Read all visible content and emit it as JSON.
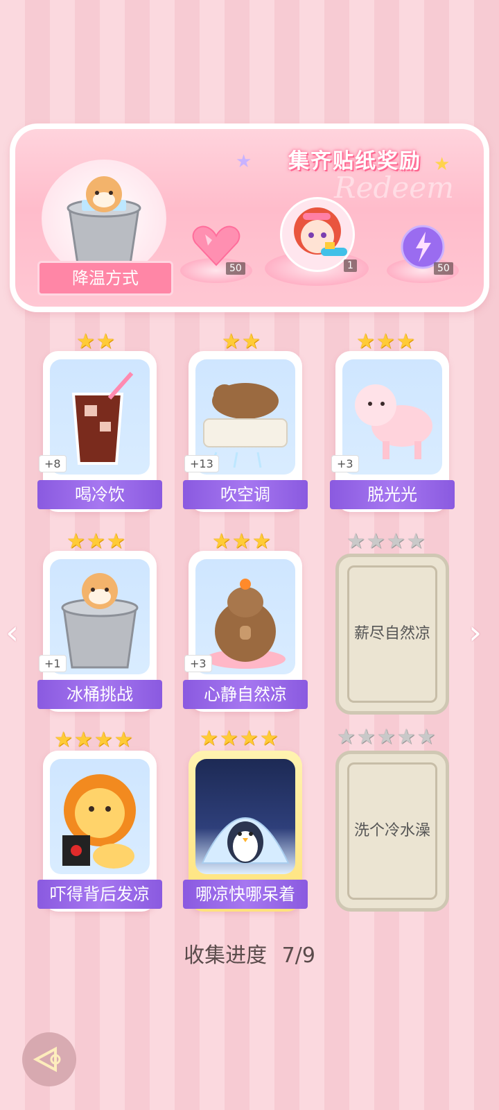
{
  "banner": {
    "title": "集齐贴纸奖励",
    "script": "Redeem",
    "main_label": "降温方式",
    "rewards": [
      {
        "icon": "pink-heart-gem-icon",
        "count": "50"
      },
      {
        "icon": "character-avatar-icon",
        "count": "1"
      },
      {
        "icon": "purple-energy-orb-icon",
        "count": "50"
      }
    ]
  },
  "cards": [
    {
      "title": "喝冷饮",
      "bonus": "+8",
      "stars": 2,
      "locked": false,
      "icon": "iced-drink-icon"
    },
    {
      "title": "吹空调",
      "bonus": "+13",
      "stars": 2,
      "locked": false,
      "icon": "capybara-aircon-icon"
    },
    {
      "title": "脱光光",
      "bonus": "+3",
      "stars": 3,
      "locked": false,
      "icon": "pink-sheep-icon"
    },
    {
      "title": "冰桶挑战",
      "bonus": "+1",
      "stars": 3,
      "locked": false,
      "icon": "hamster-bucket-icon"
    },
    {
      "title": "心静自然凉",
      "bonus": "+3",
      "stars": 3,
      "locked": false,
      "icon": "meditating-capybara-icon"
    },
    {
      "title": "薪尽自然凉",
      "bonus": "",
      "stars": 4,
      "locked": true,
      "icon": "locked-card-icon"
    },
    {
      "title": "吓得背后发凉",
      "bonus": "",
      "stars": 4,
      "locked": false,
      "icon": "scared-lion-icon"
    },
    {
      "title": "哪凉快哪呆着",
      "bonus": "",
      "stars": 4,
      "locked": false,
      "icon": "penguin-igloo-icon"
    },
    {
      "title": "洗个冷水澡",
      "bonus": "",
      "stars": 5,
      "locked": true,
      "icon": "locked-card-icon"
    }
  ],
  "progress": {
    "label": "收集进度",
    "value": "7/9",
    "collected": 7,
    "total": 9
  },
  "colors": {
    "accent": "#8a5ae0",
    "banner_pink": "#ffbccb",
    "gold_star": "#ffcb37"
  }
}
